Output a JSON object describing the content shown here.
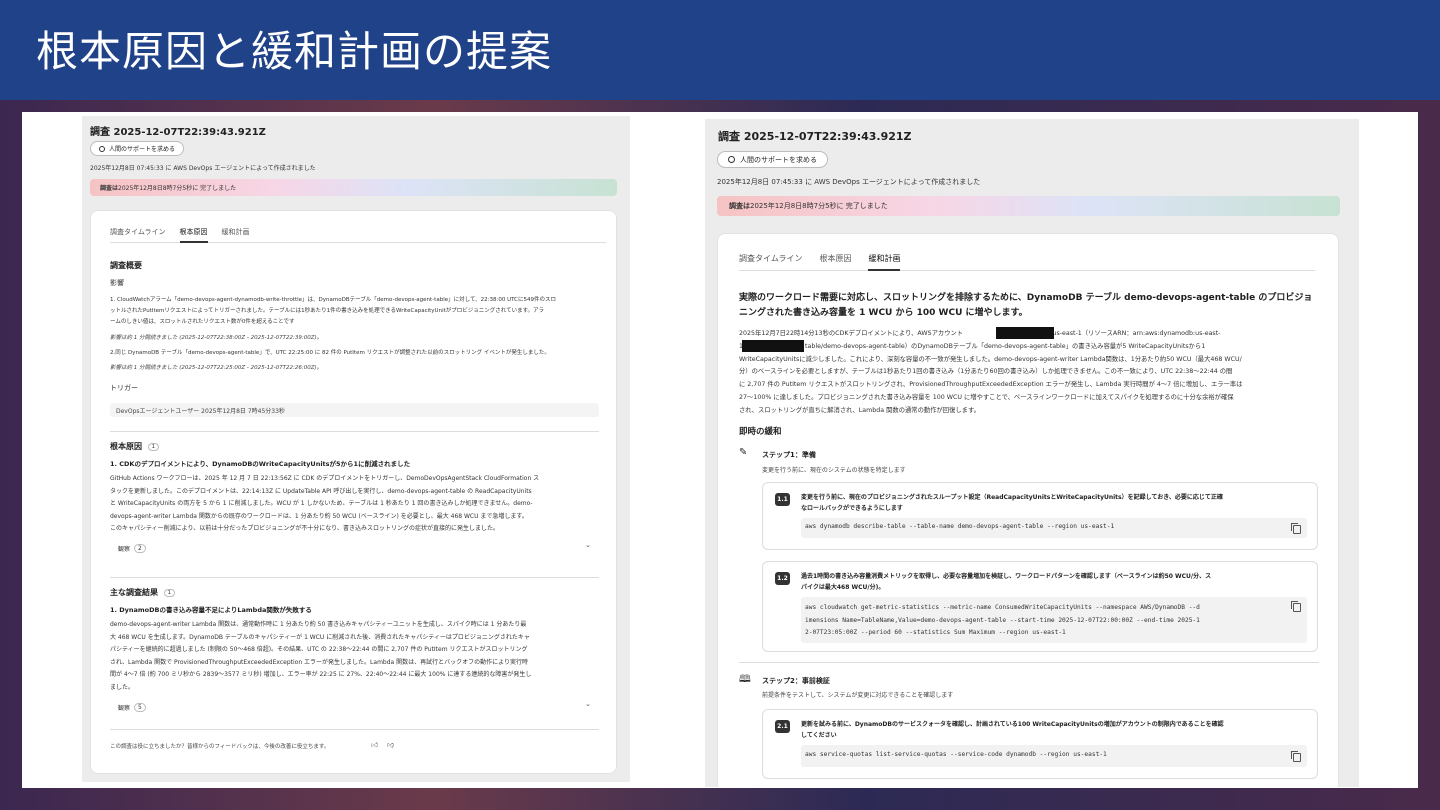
{
  "slide": {
    "title": "根本原因と緩和計画の提案"
  },
  "left": {
    "title": "調査 2025-12-07T22:39:43.921Z",
    "help_button": "人間のサポートを求める",
    "created": "2025年12月8日 07:45:33 に AWS DevOps エージェントによって作成されました",
    "banner_bold": "調査は",
    "banner_rest": "2025年12月8日8時7分5秒に 完了しました",
    "tabs": [
      "調査タイムライン",
      "根本原因",
      "緩和計画"
    ],
    "summary_heading": "調査概要",
    "impact_label": "影響",
    "impact_1_a": "1. CloudWatchアラーム「demo-devops-agent-dynamodb-write-throttle」は、DynamoDBテーブル「demo-devops-agent-table」に対して、22:38:00 UTCに549件のスロ",
    "impact_1_b": "ットルされたPutItemリクエストによってトリガーされました。テーブルには1秒あたり1件の書き込みを処理できるWriteCapacityUnitがプロビジョニングされています。アラ",
    "impact_1_c": "ームのしきい値は、スロットルされたリクエスト数が0件を超えることです",
    "impact_1_time": "影響は約 1 分間続きました (2025-12-07T22:38:00Z - 2025-12-07T22:39:00Z)。",
    "impact_2": "2.同じ DynamoDB テーブル「demo-devops-agent-table」で、UTC 22:25:00 に 82 件の PutItem リクエストが調整された以前のスロットリング イベントが発生しました。",
    "impact_2_time": "影響は約 1 分間続きました (2025-12-07T22:25:00Z - 2025-12-07T22:26:00Z)。",
    "trigger_label": "トリガー",
    "trigger_value": "DevOpsエージェントユーザー 2025年12月8日 7時45分33秒",
    "root_heading": "根本原因",
    "root_count": "1",
    "root_sub": "1. CDKのデプロイメントにより、DynamoDBのWriteCapacityUnitsが5から1に削減されました",
    "root_p1": "GitHub Actions ワークフローは、2025 年 12 月 7 日 22:13:56Z に CDK のデプロイメントをトリガーし、DemoDevOpsAgentStack CloudFormation ス",
    "root_p2": "タックを更新しました。このデプロイメントは、22:14:13Z に UpdateTable API 呼び出しを実行し、demo-devops-agent-table の ReadCapacityUnits",
    "root_p3": "と WriteCapacityUnits の両方を 5 から 1 に削減しました。WCU が 1 しかないため、テーブルは 1 秒あたり 1 回の書き込みしか処理できません。demo-",
    "root_p4": "devops-agent-writer Lambda 関数からの既存のワークロードは、1 分あたり約 50 WCU (ベースライン) を必要とし、最大 468 WCU まで急増します。",
    "root_p5": "このキャパシティー削減により、以前は十分だったプロビジョニングが不十分になり、書き込みスロットリングの症状が直接的に発生しました。",
    "root_obs_label": "観察",
    "root_obs_count": "2",
    "find_heading": "主な調査結果",
    "find_count": "1",
    "find_sub": "1. DynamoDBの書き込み容量不足によりLambda関数が失敗する",
    "find_p1": "demo-devops-agent-writer Lambda 関数は、通常動作時に 1 分あたり約 50 書き込みキャパシティーユニットを生成し、スパイク時には 1 分あたり最",
    "find_p2": "大 468 WCU を生成します。DynamoDB テーブルのキャパシティーが 1 WCU に削減された後、消費されたキャパシティーはプロビジョニングされたキャ",
    "find_p3": "パシティーを継続的に超過しました (制限の 50～468 倍超)。その結果、UTC の 22:38～22:44 の間に 2,707 件の PutItem リクエストがスロットリング",
    "find_p4": "され、Lambda 関数で ProvisionedThroughputExceededException エラーが発生しました。Lambda 関数は、再試行とバックオフの動作により実行時",
    "find_p5": "間が 4～7 倍 (約 700 ミリ秒から 2839～3577 ミリ秒) 増加し、エラー率が 22:25 に 27%、22:40～22:44 に最大 100% に達する連続的な障害が発生し",
    "find_p6": "ました。",
    "find_obs_label": "観察",
    "find_obs_count": "5",
    "feedback": "この調査は役に立ちましたか？皆様からのフィードバックは、今後の改善に役立ちます。"
  },
  "right": {
    "title": "調査 2025-12-07T22:39:43.921Z",
    "help_button": "人間のサポートを求める",
    "created": "2025年12月8日 07:45:33 に AWS DevOps エージェントによって作成されました",
    "banner_bold": "調査は",
    "banner_rest": "2025年12月8日8時7分5秒に 完了しました",
    "tabs": [
      "調査タイムライン",
      "根本原因",
      "緩和計画"
    ],
    "heading_1": "実際のワークロード需要に対応し、スロットリングを排除するために、DynamoDB テーブル demo-devops-agent-table のプロビジョ",
    "heading_2": "ニングされた書き込み容量を 1 WCU から 100 WCU に増やします。",
    "p1_a": "2025年12月7日22時14分13秒のCDKデプロイメントにより、AWSアカウント",
    "p1_b": "リージョンus-east-1（リソースARN：arn:aws:dynamodb:us-east-",
    "p2_a": "1",
    "p2_b": "table/demo-devops-agent-table）のDynamoDBテーブル「demo-devops-agent-table」の書き込み容量が5 WriteCapacityUnitsから1",
    "p3": "WriteCapacityUnitsに減少しました。これにより、深刻な容量の不一致が発生しました。demo-devops-agent-writer Lambda関数は、1分あたり約50 WCU（最大468 WCU/",
    "p4": "分）のベースラインを必要としますが、テーブルは1秒あたり1回の書き込み（1分あたり60回の書き込み）しか処理できません。この不一致により、UTC 22:38～22:44 の間",
    "p5": "に 2,707 件の PutItem リクエストがスロットリングされ、ProvisionedThroughputExceededException エラーが発生し、Lambda 実行時間が 4～7 倍に増加し、エラー率は",
    "p6": "27～100% に達しました。プロビジョニングされた書き込み容量を 100 WCU に増やすことで、ベースラインワークロードに加えてスパイクを処理するのに十分な余裕が確保",
    "p7": "され、スロットリングが直ちに解消され、Lambda 関数の通常の動作が回復します。",
    "immediate": "即時の緩和",
    "step1_title": "ステップ1：準備",
    "step1_desc": "変更を行う前に、現在のシステムの状態を特定します",
    "s11_num": "1.1",
    "s11_t1": "変更を行う前に、現在のプロビジョニングされたスループット設定（ReadCapacityUnitsとWriteCapacityUnits）を記録しておき、必要に応じて正確",
    "s11_t2": "なロールバックができるようにします",
    "s11_code": "aws dynamodb describe-table --table-name demo-devops-agent-table --region us-east-1",
    "s12_num": "1.2",
    "s12_t1": "過去1時間の書き込み容量消費メトリックを取得し、必要な容量増加を検証し、ワークロードパターンを確認します（ベースラインは約50 WCU/分、ス",
    "s12_t2": "パイクは最大468 WCU/分)。",
    "s12_code1": "aws cloudwatch get-metric-statistics --metric-name ConsumedWriteCapacityUnits --namespace AWS/DynamoDB --d",
    "s12_code2": "imensions Name=TableName,Value=demo-devops-agent-table --start-time 2025-12-07T22:00:00Z --end-time 2025-1",
    "s12_code3": "2-07T23:05:00Z --period 60 --statistics Sum Maximum --region us-east-1",
    "step2_title": "ステップ2：事前検証",
    "step2_desc": "前提条件をテストして、システムが変更に対応できることを確認します",
    "s21_num": "2.1",
    "s21_t1": "更新を試みる前に、DynamoDBのサービスクォータを確認し、計画されている100 WriteCapacityUnitsの増加がアカウントの制限内であることを確認",
    "s21_t2": "してください",
    "s21_code": "aws service-quotas list-service-quotas --service-code dynamodb --region us-east-1"
  }
}
